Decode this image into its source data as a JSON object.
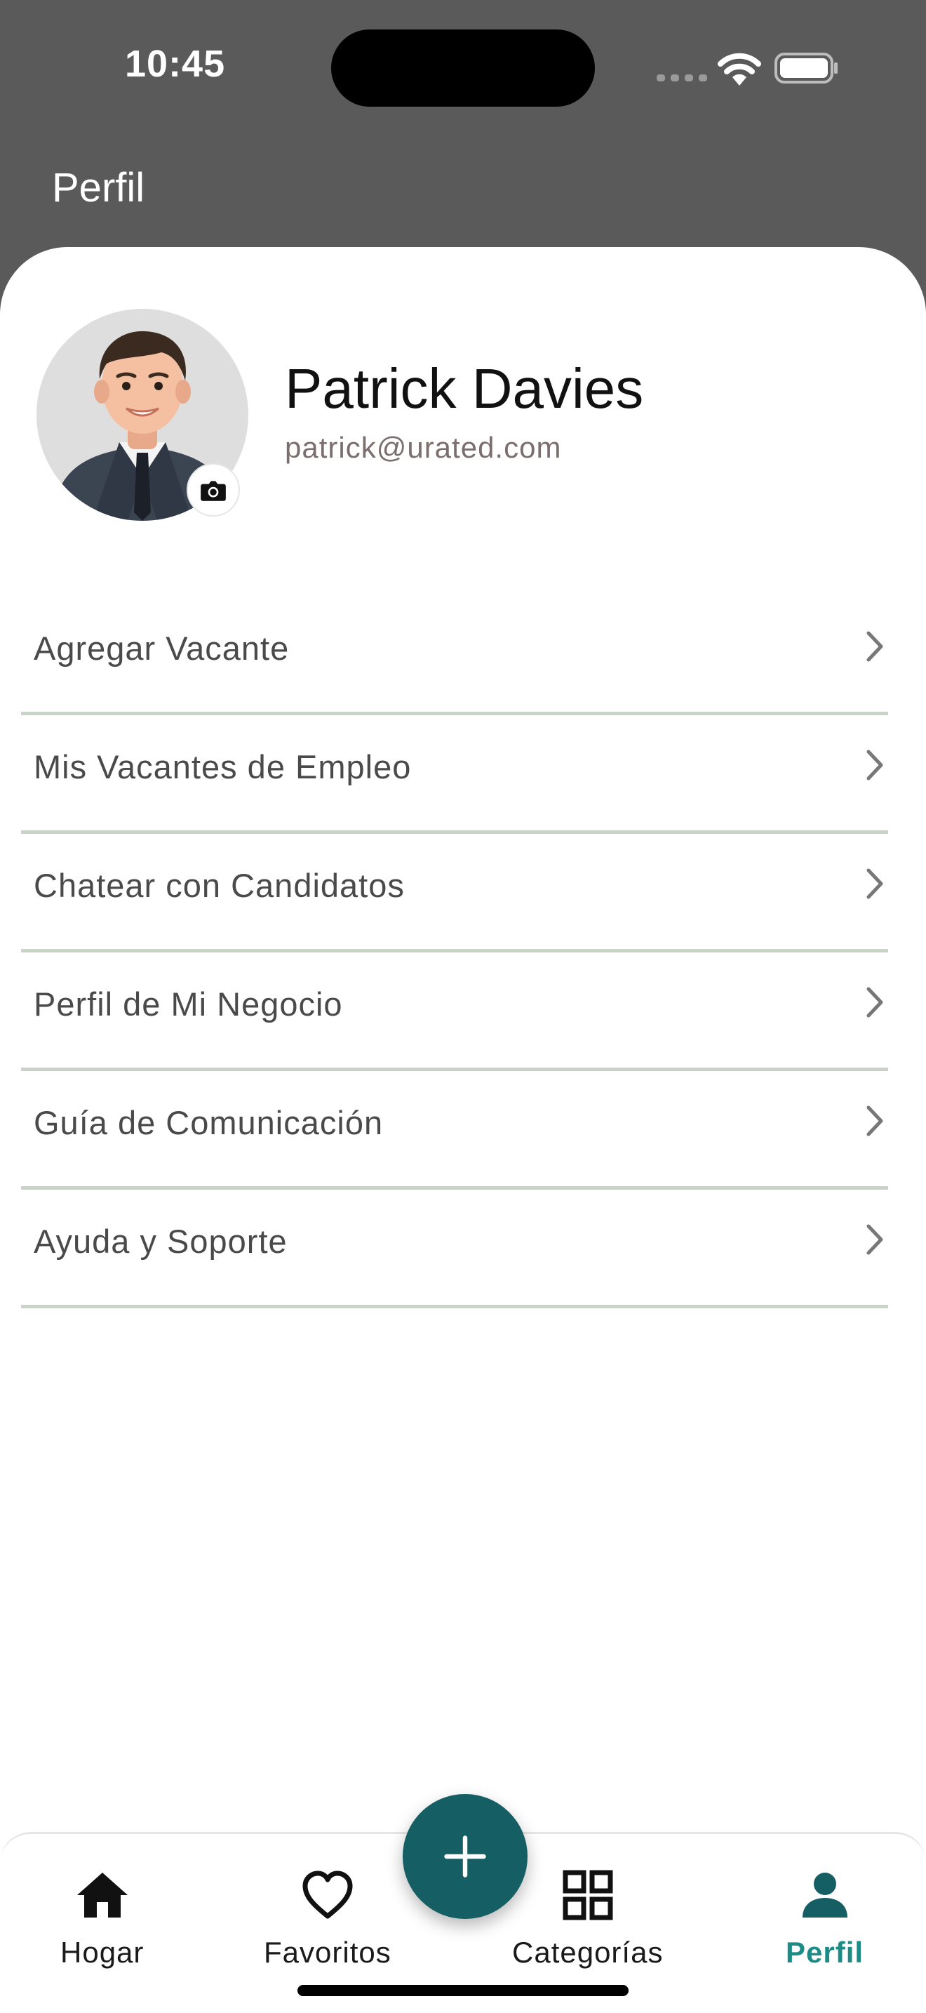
{
  "status_bar": {
    "time": "10:45"
  },
  "header": {
    "title": "Perfil"
  },
  "profile": {
    "name": "Patrick Davies",
    "email": "patrick@urated.com"
  },
  "menu": {
    "items": [
      {
        "label": "Agregar Vacante"
      },
      {
        "label": "Mis Vacantes de Empleo"
      },
      {
        "label": "Chatear con Candidatos"
      },
      {
        "label": "Perfil de Mi Negocio"
      },
      {
        "label": "Guía de Comunicación"
      },
      {
        "label": "Ayuda y Soporte"
      }
    ]
  },
  "bottom_nav": {
    "items": [
      {
        "label": "Hogar",
        "icon": "home-icon"
      },
      {
        "label": "Favoritos",
        "icon": "heart-icon"
      },
      {
        "label": "Categorías",
        "icon": "grid-icon"
      },
      {
        "label": "Perfil",
        "icon": "person-icon",
        "active": true
      }
    ]
  },
  "colors": {
    "header_bg": "#5a5a5a",
    "accent": "#155e63",
    "active_nav": "#1b8d86",
    "divider": "#c9d3c7"
  }
}
